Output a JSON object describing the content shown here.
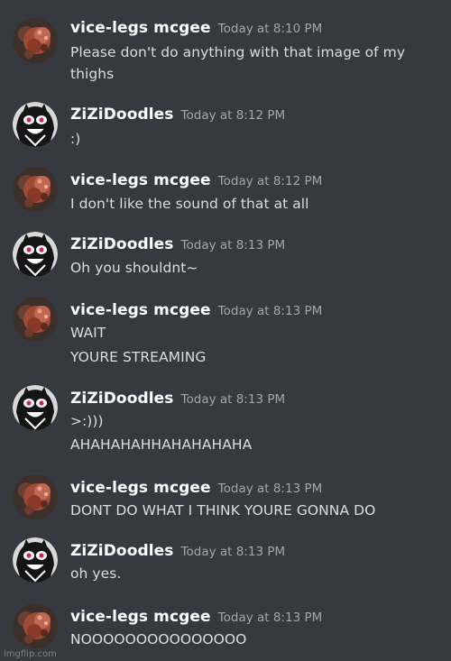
{
  "messages": [
    {
      "author": "vice-legs mcgee",
      "timestamp": "Today at 8:10 PM",
      "avatar_icon": "crab-avatar-icon",
      "lines": [
        "Please don't do anything with that image of my",
        "thighs"
      ]
    },
    {
      "author": "ZiZiDoodles",
      "timestamp": "Today at 8:12 PM",
      "avatar_icon": "doodle-character-avatar-icon",
      "lines": [
        ":)"
      ]
    },
    {
      "author": "vice-legs mcgee",
      "timestamp": "Today at 8:12 PM",
      "avatar_icon": "crab-avatar-icon",
      "lines": [
        "I don't like the sound of that at all"
      ]
    },
    {
      "author": "ZiZiDoodles",
      "timestamp": "Today at 8:13 PM",
      "avatar_icon": "doodle-character-avatar-icon",
      "lines": [
        "Oh you shouldnt~"
      ]
    },
    {
      "author": "vice-legs mcgee",
      "timestamp": "Today at 8:13 PM",
      "avatar_icon": "crab-avatar-icon",
      "lines": [
        "WAIT",
        "YOURE STREAMING"
      ]
    },
    {
      "author": "ZiZiDoodles",
      "timestamp": "Today at 8:13 PM",
      "avatar_icon": "doodle-character-avatar-icon",
      "lines": [
        ">:)))",
        "AHAHAHAHHAHAHAHAHA"
      ]
    },
    {
      "author": "vice-legs mcgee",
      "timestamp": "Today at 8:13 PM",
      "avatar_icon": "crab-avatar-icon",
      "lines": [
        "DONT DO WHAT I THINK YOURE GONNA DO"
      ]
    },
    {
      "author": "ZiZiDoodles",
      "timestamp": "Today at 8:13 PM",
      "avatar_icon": "doodle-character-avatar-icon",
      "lines": [
        "oh yes."
      ]
    },
    {
      "author": "vice-legs mcgee",
      "timestamp": "Today at 8:13 PM",
      "avatar_icon": "crab-avatar-icon",
      "lines": [
        "NOOOOOOOOOOOOOOO"
      ]
    }
  ],
  "colors": {
    "background": "#36393f",
    "username": "#ffffff",
    "timestamp": "#a3a6aa",
    "message_text": "#dcddde"
  },
  "watermark": "imgflip.com"
}
